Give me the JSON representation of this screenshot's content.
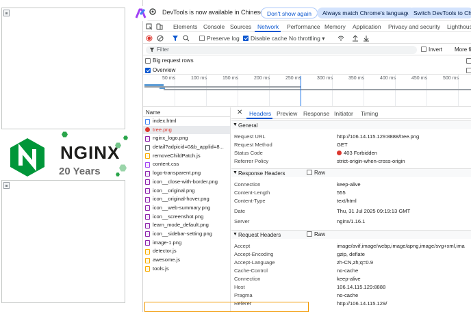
{
  "page": {
    "logo": {
      "brand": "NGINX",
      "years": "20 Years"
    }
  },
  "infobar": {
    "message": "DevTools is now available in Chinese",
    "dont_show": "Don't show again",
    "match_lang": "Always match Chrome's language",
    "switch": "Switch DevTools to Chinese"
  },
  "tabs": [
    "Elements",
    "Console",
    "Sources",
    "Network",
    "Performance",
    "Memory",
    "Application",
    "Privacy and security",
    "Lighthouse"
  ],
  "active_tab": "Network",
  "toolbar": {
    "preserve_log": "Preserve log",
    "disable_cache": "Disable cache",
    "throttling": "No throttling"
  },
  "filter": {
    "placeholder": "Filter",
    "invert": "Invert",
    "more": "More fi"
  },
  "options": {
    "big_rows": "Big request rows",
    "overview": "Overview"
  },
  "timeline_ticks": [
    "50 ms",
    "100 ms",
    "150 ms",
    "200 ms",
    "250 ms",
    "300 ms",
    "350 ms",
    "400 ms",
    "450 ms",
    "500 ms"
  ],
  "list": {
    "header": "Name",
    "items": [
      {
        "name": "index.html",
        "type": "doc"
      },
      {
        "name": "tree.png",
        "type": "error"
      },
      {
        "name": "nginx_logo.png",
        "type": "img"
      },
      {
        "name": "detail?adpicid=0&b_applid=8...",
        "type": "xhr"
      },
      {
        "name": "removeChildPatch.js",
        "type": "js"
      },
      {
        "name": "content.css",
        "type": "css"
      },
      {
        "name": "logo-transparent.png",
        "type": "img"
      },
      {
        "name": "icon__close-with-border.png",
        "type": "img"
      },
      {
        "name": "icon__original.png",
        "type": "img"
      },
      {
        "name": "icon__original-hover.png",
        "type": "img"
      },
      {
        "name": "icon__web-summary.png",
        "type": "img"
      },
      {
        "name": "icon__screenshot.png",
        "type": "img"
      },
      {
        "name": "learn_mode_default.png",
        "type": "img"
      },
      {
        "name": "icon__sidebar-setting.png",
        "type": "img"
      },
      {
        "name": "image-1.png",
        "type": "img"
      },
      {
        "name": "detector.js",
        "type": "js"
      },
      {
        "name": "awesome.js",
        "type": "js"
      },
      {
        "name": "tools.js",
        "type": "js"
      }
    ]
  },
  "detail_tabs": [
    "Headers",
    "Preview",
    "Response",
    "Initiator",
    "Timing"
  ],
  "sections": {
    "general": "General",
    "response": "Response Headers",
    "request": "Request Headers",
    "raw": "Raw"
  },
  "general": [
    {
      "k": "Request URL",
      "v": "http://106.14.115.129:8888/tree.png"
    },
    {
      "k": "Request Method",
      "v": "GET"
    },
    {
      "k": "Status Code",
      "v": "403 Forbidden"
    },
    {
      "k": "Referrer Policy",
      "v": "strict-origin-when-cross-origin"
    }
  ],
  "response_headers": [
    {
      "k": "Connection",
      "v": "keep-alive"
    },
    {
      "k": "Content-Length",
      "v": "555"
    },
    {
      "k": "Content-Type",
      "v": "text/html"
    },
    {
      "k": "Date",
      "v": "Thu, 31 Jul 2025 09:19:13 GMT"
    },
    {
      "k": "Server",
      "v": "nginx/1.16.1"
    }
  ],
  "request_headers": [
    {
      "k": "Accept",
      "v": "image/avif,image/webp,image/apng,image/svg+xml,ima"
    },
    {
      "k": "Accept-Encoding",
      "v": "gzip, deflate"
    },
    {
      "k": "Accept-Language",
      "v": "zh-CN,zh;q=0.9"
    },
    {
      "k": "Cache-Control",
      "v": "no-cache"
    },
    {
      "k": "Connection",
      "v": "keep-alive"
    },
    {
      "k": "Host",
      "v": "106.14.115.129:8888"
    },
    {
      "k": "Pragma",
      "v": "no-cache"
    },
    {
      "k": "Referer",
      "v": "http://106.14.115.129/"
    }
  ],
  "colors": {
    "accent": "#0b57d0",
    "error": "#dc362e",
    "nginx_green": "#009639",
    "highlight": "#f29900"
  }
}
